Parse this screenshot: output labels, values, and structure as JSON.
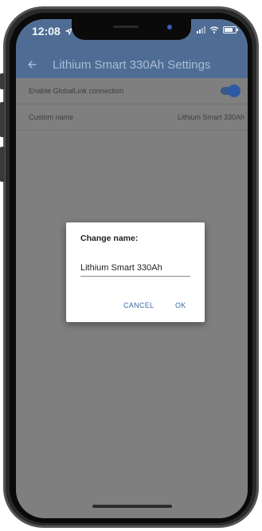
{
  "status_bar": {
    "time": "12:08",
    "location_icon": "location-arrow-icon",
    "signal_icon": "cellular-signal-icon",
    "wifi_icon": "wifi-icon",
    "battery_icon": "battery-icon",
    "battery_level": 0.8
  },
  "header": {
    "back_icon": "arrow-left-icon",
    "title": "Lithium Smart 330Ah Settings",
    "color": "#4f6d94"
  },
  "settings": {
    "globallink": {
      "label": "Enable GlobalLink connection",
      "enabled": true
    },
    "custom_name": {
      "label": "Custom name",
      "value": "Lithium Smart 330Ah"
    }
  },
  "dialog": {
    "title": "Change name:",
    "input_value": "Lithium Smart 330Ah",
    "cancel_label": "CANCEL",
    "ok_label": "OK",
    "accent_color": "#3a6ea8"
  }
}
